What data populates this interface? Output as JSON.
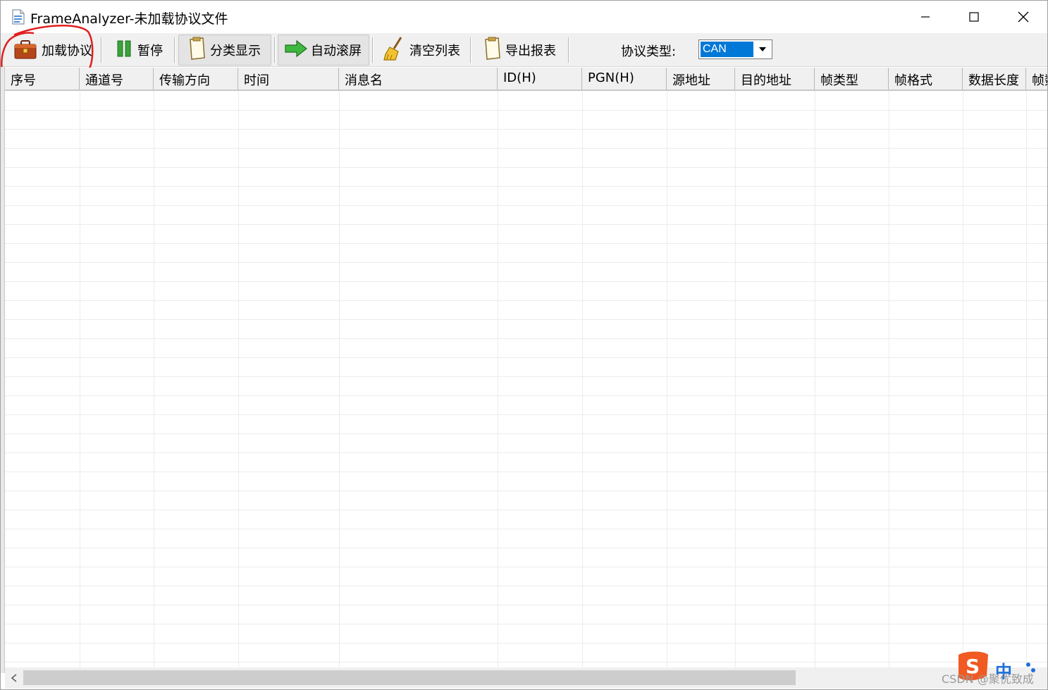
{
  "window": {
    "title": "FrameAnalyzer-未加载协议文件"
  },
  "toolbar": {
    "buttons": [
      {
        "label": "加载协议",
        "icon": "toolbox-icon"
      },
      {
        "label": "暂停",
        "icon": "pause-icon"
      },
      {
        "label": "分类显示",
        "icon": "clipboard-icon"
      },
      {
        "label": "自动滚屏",
        "icon": "green-arrow-icon"
      },
      {
        "label": "清空列表",
        "icon": "broom-icon"
      },
      {
        "label": "导出报表",
        "icon": "clipboard-icon"
      }
    ],
    "protocol_label": "协议类型:",
    "protocol_value": "CAN"
  },
  "table": {
    "columns": [
      "序号",
      "通道号",
      "传输方向",
      "时间",
      "消息名",
      "ID(H)",
      "PGN(H)",
      "源地址",
      "目的地址",
      "帧类型",
      "帧格式",
      "数据长度",
      "帧数据"
    ],
    "rows": []
  },
  "ime": {
    "mode": "中"
  },
  "watermark": "CSDN @聚优致成",
  "colors": {
    "selection": "#0078d7",
    "annotation": "#e02020",
    "ime_brand": "#f15a22"
  }
}
